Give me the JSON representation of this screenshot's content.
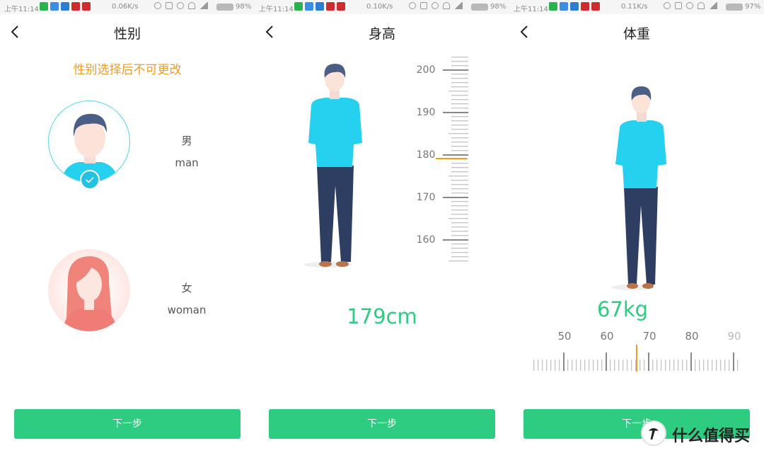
{
  "status_bars": [
    {
      "time": "上午11:14",
      "speed": "0.06K/s",
      "battery": "98%"
    },
    {
      "time": "上午11:14",
      "speed": "0.10K/s",
      "battery": "98%"
    },
    {
      "time": "上午11:14",
      "speed": "0.11K/s",
      "battery": "97%"
    }
  ],
  "colors": {
    "accent_green": "#2ecc80",
    "notice_orange": "#f29b26",
    "indicator_orange": "#f29b26",
    "shirt_blue": "#26d0ef",
    "pants_navy": "#2e3e63",
    "hair": "#4b5f86"
  },
  "gender_page": {
    "title": "性别",
    "notice": "性别选择后不可更改",
    "options": [
      {
        "cn": "男",
        "en": "man",
        "selected": true
      },
      {
        "cn": "女",
        "en": "woman",
        "selected": false
      }
    ],
    "next_button": "下一步"
  },
  "height_page": {
    "title": "身高",
    "value": "179cm",
    "ruler": {
      "labels": [
        "200",
        "190",
        "180",
        "170",
        "160"
      ],
      "selected": 179,
      "unit": "cm"
    },
    "next_button": "下一步"
  },
  "weight_page": {
    "title": "体重",
    "value": "67kg",
    "ruler": {
      "labels": [
        "50",
        "60",
        "70",
        "80",
        "90"
      ],
      "selected": 67,
      "unit": "kg"
    },
    "next_button": "下一步"
  },
  "watermark": {
    "text": "什么值得买",
    "icon": "smzdm-logo-icon"
  }
}
